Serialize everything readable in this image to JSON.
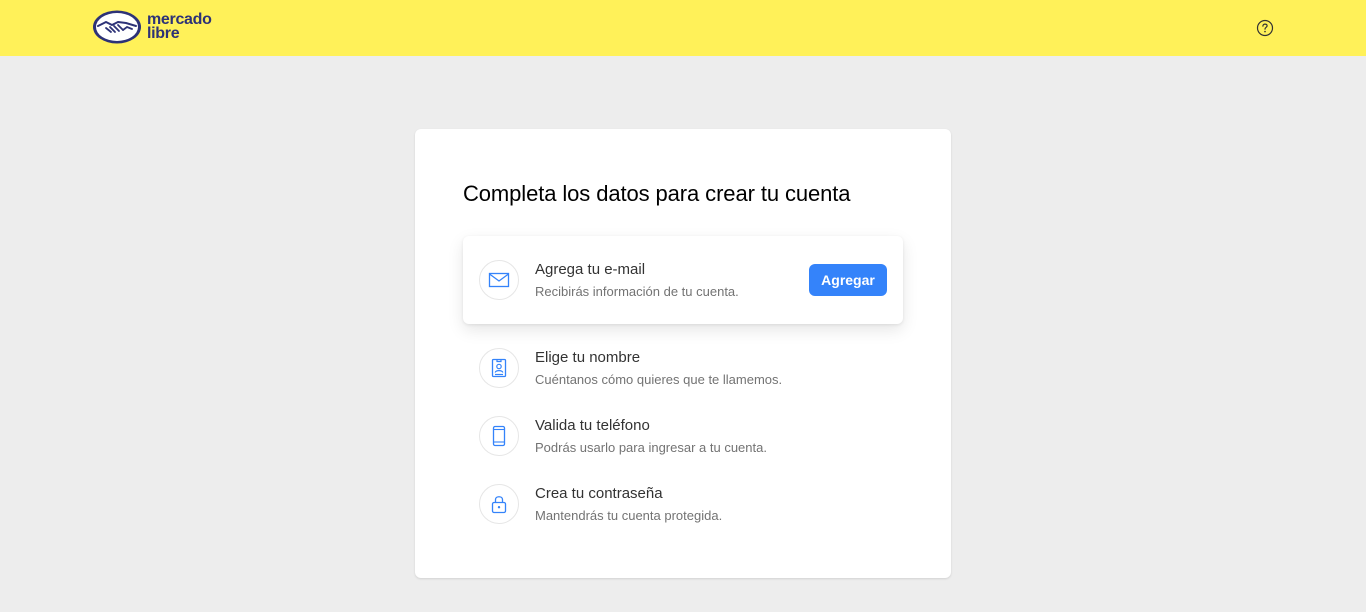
{
  "header": {
    "brand_line1": "mercado",
    "brand_line2": "libre",
    "help_icon": "question-circle-icon",
    "background": "#fff159"
  },
  "card": {
    "title": "Completa los datos para crear tu cuenta"
  },
  "steps": [
    {
      "icon": "envelope-icon",
      "title": "Agrega tu e-mail",
      "subtitle": "Recibirás información de tu cuenta.",
      "button_label": "Agregar",
      "active": true
    },
    {
      "icon": "id-badge-icon",
      "title": "Elige tu nombre",
      "subtitle": "Cuéntanos cómo quieres que te llamemos.",
      "active": false
    },
    {
      "icon": "phone-icon",
      "title": "Valida tu teléfono",
      "subtitle": "Podrás usarlo para ingresar a tu cuenta.",
      "active": false
    },
    {
      "icon": "lock-icon",
      "title": "Crea tu contraseña",
      "subtitle": "Mantendrás tu cuenta protegida.",
      "active": false
    }
  ],
  "colors": {
    "accent": "#3483fa",
    "brand_navy": "#2d3277",
    "page_bg": "#ededed"
  }
}
